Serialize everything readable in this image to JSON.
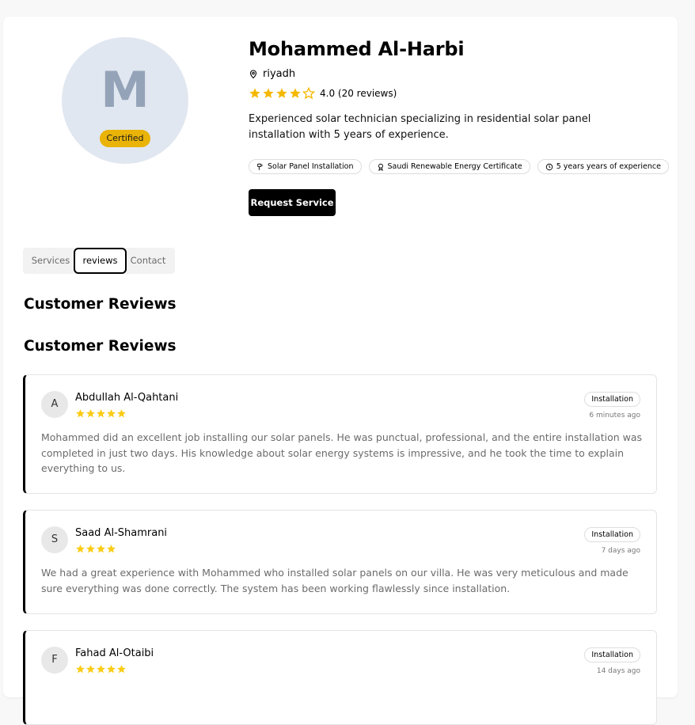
{
  "profile": {
    "initial": "M",
    "certified_label": "Certified",
    "name": "Mohammed Al-Harbi",
    "location": "riyadh",
    "rating_value": 4,
    "rating_text": "4.0 (20 reviews)",
    "bio": "Experienced solar technician specializing in residential solar panel installation with 5 years of experience.",
    "chips": [
      {
        "label": "Solar Panel Installation",
        "icon": "tool-icon"
      },
      {
        "label": "Saudi Renewable Energy Certificate",
        "icon": "award-icon"
      },
      {
        "label": "5 years years of experience",
        "icon": "clock-icon"
      }
    ],
    "request_button": "Request Service"
  },
  "tabs": {
    "services": "Services",
    "reviews": "reviews",
    "contact": "Contact",
    "active": "reviews"
  },
  "reviews_section": {
    "heading1": "Customer Reviews",
    "heading2": "Customer Reviews",
    "items": [
      {
        "initial": "A",
        "name": "Abdullah Al-Qahtani",
        "stars": 5,
        "tag": "Installation",
        "time": "6 minutes ago",
        "text": "Mohammed did an excellent job installing our solar panels. He was punctual, professional, and the entire installation was completed in just two days. His knowledge about solar energy systems is impressive, and he took the time to explain everything to us."
      },
      {
        "initial": "S",
        "name": "Saad Al-Shamrani",
        "stars": 4,
        "tag": "Installation",
        "time": "7 days ago",
        "text": "We had a great experience with Mohammed who installed solar panels on our villa. He was very meticulous and made sure everything was done correctly. The system has been working flawlessly since installation."
      },
      {
        "initial": "F",
        "name": "Fahad Al-Otaibi",
        "stars": 5,
        "tag": "Installation",
        "time": "14 days ago",
        "text": ""
      }
    ]
  },
  "colors": {
    "star": "#f5b800",
    "review_star": "#facc15",
    "badge": "#eab308"
  }
}
